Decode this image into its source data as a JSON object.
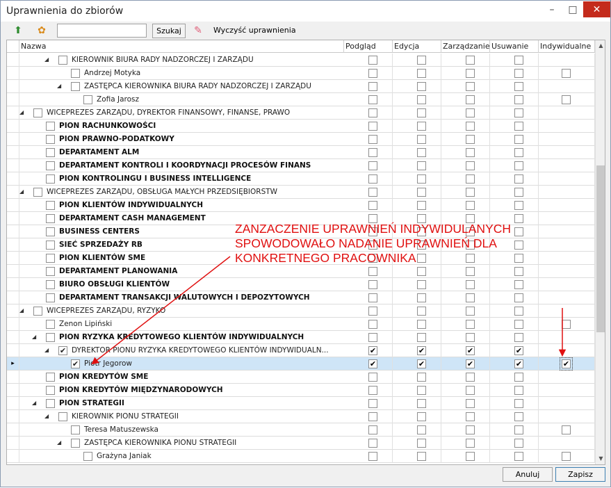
{
  "window": {
    "title": "Uprawnienia do zbiorów"
  },
  "toolbar": {
    "search_placeholder": "",
    "search_label": "Szukaj",
    "clear_label": "Wyczyść uprawnienia"
  },
  "columns": [
    "Nazwa",
    "Podgląd",
    "Edycja",
    "Zarządzanie",
    "Usuwanie",
    "Indywidualne"
  ],
  "rows": [
    {
      "label": "KIEROWNIK BIURA RADY NADZORCZEJ I ZARZĄDU",
      "level": 4,
      "bold": false,
      "expand": true,
      "checked": false,
      "perms": [
        false,
        false,
        false,
        false
      ],
      "indiv": null
    },
    {
      "label": "Andrzej Motyka",
      "level": 5,
      "bold": false,
      "expand": false,
      "checked": false,
      "perms": [
        false,
        false,
        false,
        false
      ],
      "indiv": false
    },
    {
      "label": "ZASTĘPCA KIEROWNIKA BIURA RADY NADZORCZEJ I ZARZĄDU",
      "level": 5,
      "bold": false,
      "expand": true,
      "checked": false,
      "perms": [
        false,
        false,
        false,
        false
      ],
      "indiv": null
    },
    {
      "label": "Zofia Jarosz",
      "level": 6,
      "bold": false,
      "expand": false,
      "checked": false,
      "perms": [
        false,
        false,
        false,
        false
      ],
      "indiv": false
    },
    {
      "label": "WICEPREZES ZARZĄDU, DYREKTOR FINANSOWY, FINANSE, PRAWO",
      "level": 2,
      "bold": false,
      "expand": true,
      "checked": false,
      "perms": [
        false,
        false,
        false,
        false
      ],
      "indiv": null
    },
    {
      "label": "PION RACHUNKOWOŚCI",
      "level": 3,
      "bold": true,
      "expand": false,
      "checked": false,
      "perms": [
        false,
        false,
        false,
        false
      ],
      "indiv": null
    },
    {
      "label": "PION PRAWNO-PODATKOWY",
      "level": 3,
      "bold": true,
      "expand": false,
      "checked": false,
      "perms": [
        false,
        false,
        false,
        false
      ],
      "indiv": null
    },
    {
      "label": "DEPARTAMENT ALM",
      "level": 3,
      "bold": true,
      "expand": false,
      "checked": false,
      "perms": [
        false,
        false,
        false,
        false
      ],
      "indiv": null
    },
    {
      "label": "DEPARTAMENT KONTROLI I KOORDYNACJI PROCESÓW FINANS",
      "level": 3,
      "bold": true,
      "expand": false,
      "checked": false,
      "perms": [
        false,
        false,
        false,
        false
      ],
      "indiv": null
    },
    {
      "label": "PION KONTROLINGU I BUSINESS INTELLIGENCE",
      "level": 3,
      "bold": true,
      "expand": false,
      "checked": false,
      "perms": [
        false,
        false,
        false,
        false
      ],
      "indiv": null
    },
    {
      "label": "WICEPREZES ZARZĄDU, OBSŁUGA MAŁYCH PRZEDSIĘBIORSTW",
      "level": 2,
      "bold": false,
      "expand": true,
      "checked": false,
      "perms": [
        false,
        false,
        false,
        false
      ],
      "indiv": null
    },
    {
      "label": "PION KLIENTÓW INDYWIDUALNYCH",
      "level": 3,
      "bold": true,
      "expand": false,
      "checked": false,
      "perms": [
        false,
        false,
        false,
        false
      ],
      "indiv": null
    },
    {
      "label": "DEPARTAMENT CASH MANAGEMENT",
      "level": 3,
      "bold": true,
      "expand": false,
      "checked": false,
      "perms": [
        false,
        false,
        false,
        false
      ],
      "indiv": null
    },
    {
      "label": "BUSINESS CENTERS",
      "level": 3,
      "bold": true,
      "expand": false,
      "checked": false,
      "perms": [
        false,
        false,
        false,
        false
      ],
      "indiv": null
    },
    {
      "label": "SIEĆ SPRZEDAŻY RB",
      "level": 3,
      "bold": true,
      "expand": false,
      "checked": false,
      "perms": [
        false,
        false,
        false,
        false
      ],
      "indiv": null
    },
    {
      "label": "PION KLIENTÓW SME",
      "level": 3,
      "bold": true,
      "expand": false,
      "checked": false,
      "perms": [
        false,
        false,
        false,
        false
      ],
      "indiv": null
    },
    {
      "label": "DEPARTAMENT PLANOWANIA",
      "level": 3,
      "bold": true,
      "expand": false,
      "checked": false,
      "perms": [
        false,
        false,
        false,
        false
      ],
      "indiv": null
    },
    {
      "label": "BIURO OBSŁUGI KLIENTÓW",
      "level": 3,
      "bold": true,
      "expand": false,
      "checked": false,
      "perms": [
        false,
        false,
        false,
        false
      ],
      "indiv": null
    },
    {
      "label": "DEPARTAMENT TRANSAKCJI WALUTOWYCH I DEPOZYTOWYCH",
      "level": 3,
      "bold": true,
      "expand": false,
      "checked": false,
      "perms": [
        false,
        false,
        false,
        false
      ],
      "indiv": null
    },
    {
      "label": "WICEPREZES ZARZĄDU, RYZYKO",
      "level": 2,
      "bold": false,
      "expand": true,
      "checked": false,
      "perms": [
        false,
        false,
        false,
        false
      ],
      "indiv": null
    },
    {
      "label": "Zenon Lipiński",
      "level": 3,
      "bold": false,
      "expand": false,
      "checked": false,
      "perms": [
        false,
        false,
        false,
        false
      ],
      "indiv": false
    },
    {
      "label": "PION RYZYKA KREDYTOWEGO KLIENTÓW INDYWIDUALNYCH",
      "level": 3,
      "bold": true,
      "expand": true,
      "checked": false,
      "perms": [
        false,
        false,
        false,
        false
      ],
      "indiv": null
    },
    {
      "label": "DYREKTOR PIONU RYZYKA KREDYTOWEGO KLIENTÓW INDYWIDUALN...",
      "level": 4,
      "bold": false,
      "expand": true,
      "checked": true,
      "perms": [
        true,
        true,
        true,
        true
      ],
      "indiv": null
    },
    {
      "label": "Piotr Jegorow",
      "level": 5,
      "bold": false,
      "expand": false,
      "checked": true,
      "perms": [
        true,
        true,
        true,
        true
      ],
      "indiv": true,
      "selected": true
    },
    {
      "label": "PION KREDYTÓW SME",
      "level": 3,
      "bold": true,
      "expand": false,
      "checked": false,
      "perms": [
        false,
        false,
        false,
        false
      ],
      "indiv": null
    },
    {
      "label": "PION KREDYTÓW MIĘDZYNARODOWYCH",
      "level": 3,
      "bold": true,
      "expand": false,
      "checked": false,
      "perms": [
        false,
        false,
        false,
        false
      ],
      "indiv": null
    },
    {
      "label": "PION STRATEGII",
      "level": 3,
      "bold": true,
      "expand": true,
      "checked": false,
      "perms": [
        false,
        false,
        false,
        false
      ],
      "indiv": null
    },
    {
      "label": "KIEROWNIK PIONU STRATEGII",
      "level": 4,
      "bold": false,
      "expand": true,
      "checked": false,
      "perms": [
        false,
        false,
        false,
        false
      ],
      "indiv": null
    },
    {
      "label": "Teresa Matuszewska",
      "level": 5,
      "bold": false,
      "expand": false,
      "checked": false,
      "perms": [
        false,
        false,
        false,
        false
      ],
      "indiv": false
    },
    {
      "label": "ZASTĘPCA KIEROWNIKA PIONU STRATEGII",
      "level": 5,
      "bold": false,
      "expand": true,
      "checked": false,
      "perms": [
        false,
        false,
        false,
        false
      ],
      "indiv": null
    },
    {
      "label": "Grażyna Janiak",
      "level": 6,
      "bold": false,
      "expand": false,
      "checked": false,
      "perms": [
        false,
        false,
        false,
        false
      ],
      "indiv": false
    }
  ],
  "annotation": {
    "line1": "ZANZACZENIE UPRAWNIEŃ INDYWIDULANYCH",
    "line2": "SPOWODOWAŁO NADANIE UPRAWNIEŃ DLA",
    "line3": "KONKRETNEGO PRACOWNIKA",
    "color": "#e01010"
  },
  "footer": {
    "cancel_label": "Anuluj",
    "save_label": "Zapisz"
  }
}
